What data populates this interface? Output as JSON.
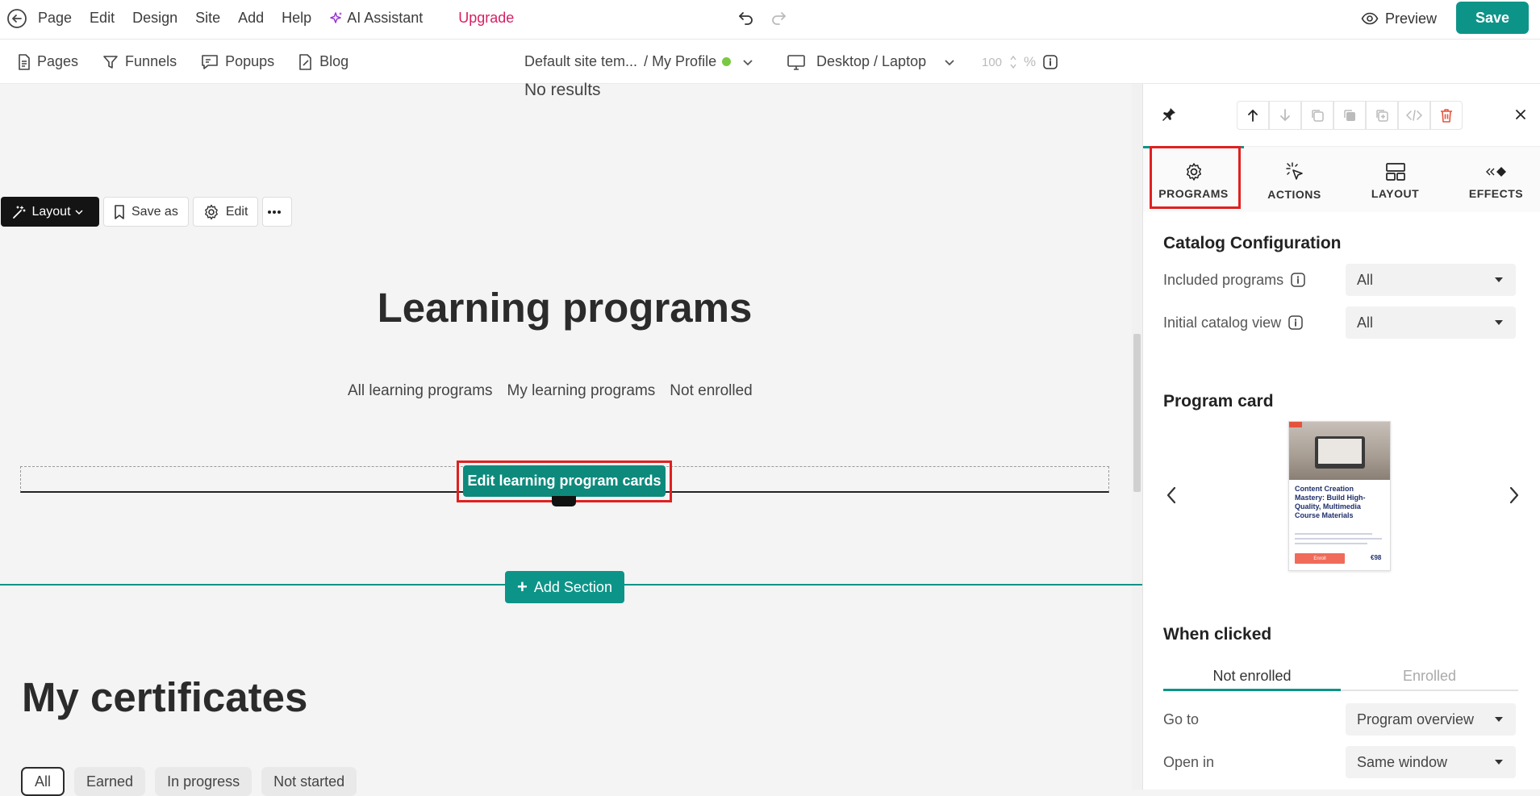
{
  "topbar": {
    "menu": [
      "Page",
      "Edit",
      "Design",
      "Site",
      "Add",
      "Help"
    ],
    "ai_label": "AI Assistant",
    "upgrade_label": "Upgrade",
    "preview_label": "Preview",
    "save_label": "Save"
  },
  "subbar": {
    "nav": [
      "Pages",
      "Funnels",
      "Popups",
      "Blog"
    ],
    "template_label": "Default site tem...",
    "page_label": "/ My Profile",
    "device_label": "Desktop / Laptop",
    "zoom_value": "100",
    "zoom_unit": "%"
  },
  "canvas": {
    "no_results": "No results",
    "section_toolbar": {
      "layout_label": "Layout",
      "save_as_label": "Save as",
      "edit_label": "Edit"
    },
    "heading": "Learning programs",
    "program_tabs": [
      "All learning programs",
      "My learning programs",
      "Not enrolled"
    ],
    "edit_cards_label": "Edit learning program cards",
    "add_section_label": "Add Section",
    "cert_heading": "My certificates",
    "cert_tabs": [
      "All",
      "Earned",
      "In progress",
      "Not started"
    ]
  },
  "panel": {
    "tabs": [
      "PROGRAMS",
      "ACTIONS",
      "LAYOUT",
      "EFFECTS"
    ],
    "catalog_title": "Catalog Configuration",
    "included_label": "Included programs",
    "included_value": "All",
    "initial_label": "Initial catalog view",
    "initial_value": "All",
    "card_title": "Program card",
    "card_preview": {
      "title": "Content Creation Mastery: Build High-Quality, Multimedia Course Materials",
      "button": "Enroll",
      "price": "€98"
    },
    "when_clicked_title": "When clicked",
    "segments": [
      "Not enrolled",
      "Enrolled"
    ],
    "goto_label": "Go to",
    "goto_value": "Program overview",
    "openin_label": "Open in",
    "openin_value": "Same window"
  },
  "colors": {
    "accent": "#0d9488",
    "ai": "#9a35d6",
    "upgrade": "#d61f63",
    "highlight": "#e02020",
    "delete": "#e5533d"
  }
}
